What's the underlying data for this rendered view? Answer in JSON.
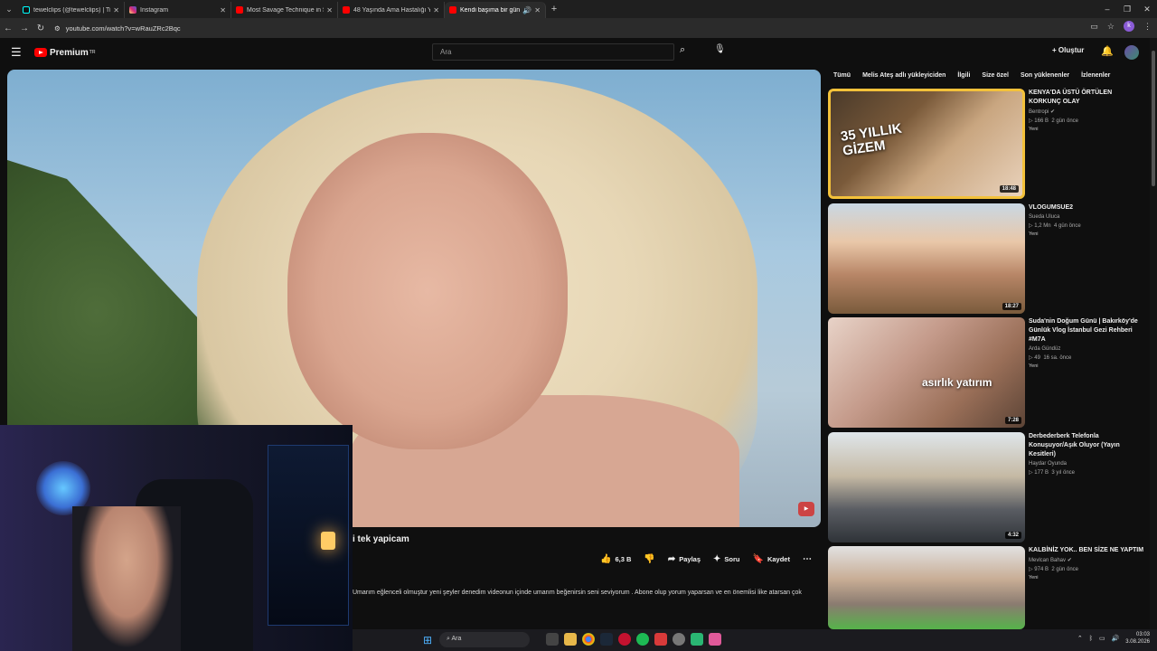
{
  "browser": {
    "tabs": [
      {
        "title": "tewelclips (@tewelclips) | TikTo",
        "fav_color": "#000000",
        "active": false
      },
      {
        "title": "Instagram",
        "fav_color": "#d62976",
        "active": false
      },
      {
        "title": "Most Savage Technique in Sum",
        "fav_color": "#ff0000",
        "active": false
      },
      {
        "title": "48 Yaşında Ama Hastalığı Yüzü",
        "fav_color": "#ff0000",
        "active": false
      },
      {
        "title": "Kendi başıma bir gün geçi",
        "fav_color": "#ff0000",
        "active": true
      }
    ],
    "url": "youtube.com/watch?v=wRauZRc2Bqc"
  },
  "youtube": {
    "logo": "Premium",
    "logo_sup": "TR",
    "search_placeholder": "Ara",
    "create_label": "Oluştur"
  },
  "video": {
    "title": "i tek yapicam",
    "like_count": "6,3 B",
    "share_label": "Paylaş",
    "ask_label": "Soru",
    "save_label": "Kaydet",
    "description": "Umarım eğlenceli olmuştur yeni şeyler denedim videonun içinde umarım beğenirsin seni seviyorum . Abone olup yorum yaparsan ve en önemlisi like atarsan çok"
  },
  "chips": [
    "Tümü",
    "Melis Ateş adlı yükleyiciden",
    "İlgili",
    "Size özel",
    "Son yüklenenler",
    "İzlenenler"
  ],
  "recommendations": [
    {
      "title": "KENYA'DA ÜSTÜ ÖRTÜLEN KORKUNÇ OLAY",
      "channel": "Bentropi",
      "verified": true,
      "views": "166 B",
      "age": "2 gün önce",
      "badge": "Yeni",
      "duration": "18:48",
      "thumb_text": "35 YILLIK GİZEM",
      "selected": true
    },
    {
      "title": "VLOGUMSUE2",
      "channel": "Sueda Ulucа",
      "verified": false,
      "views": "1,2 Mn",
      "age": "4 gün önce",
      "badge": "Yeni",
      "duration": "18:27",
      "thumb_text": "",
      "selected": false
    },
    {
      "title": "Suda'nin Doğum Günü | Bakırköy'de Günlük Vlog İstanbul Gezi Rehberi #M7A",
      "channel": "Arda Gündüz",
      "verified": false,
      "views": "49",
      "age": "16 sa. önce",
      "badge": "Yeni",
      "duration": "7:28",
      "thumb_text": "asırlık yatırım",
      "selected": false
    },
    {
      "title": "Derbederberk Telefonla Konuşuyor/Aşık Oluyor (Yayın Kesitleri)",
      "channel": "Haydar Oyunda",
      "verified": false,
      "views": "177 B",
      "age": "3 yıl önce",
      "badge": "",
      "duration": "4:32",
      "thumb_text": "",
      "selected": false
    },
    {
      "title": "KALBİNİZ YOK.. BEN SİZE NE YAPTIM",
      "channel": "Mevlcan Bahav",
      "verified": true,
      "views": "974 B",
      "age": "2 gün önce",
      "badge": "Yeni",
      "duration": "",
      "thumb_text": "",
      "selected": false
    }
  ],
  "taskbar": {
    "search_label": "Ara",
    "time": "03:03",
    "date": "3.08.2026"
  }
}
